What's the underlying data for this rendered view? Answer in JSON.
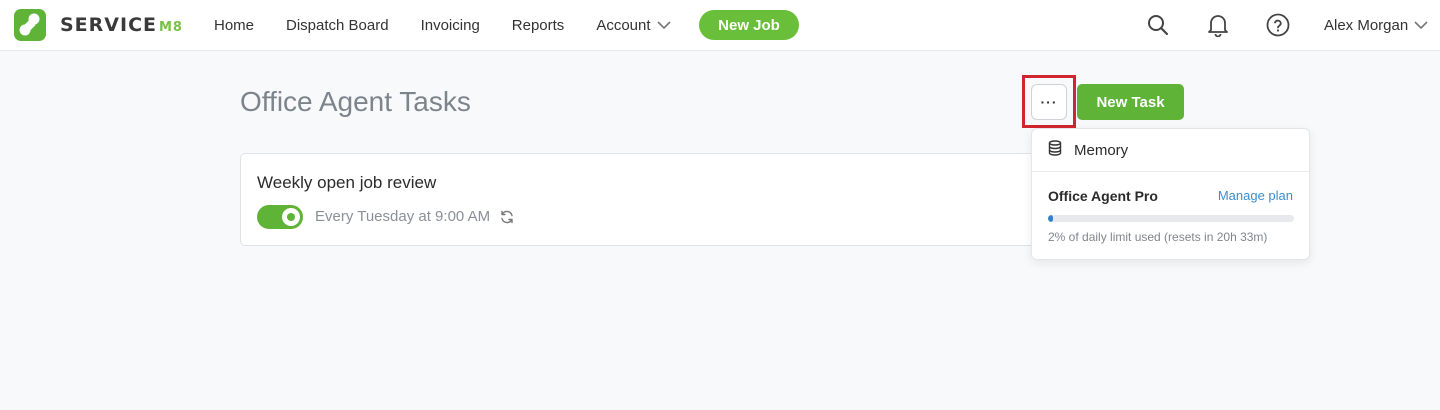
{
  "brand": {
    "name": "SERVICE",
    "suffix": "M8",
    "accent": "#5fb336"
  },
  "nav": {
    "items": [
      "Home",
      "Dispatch Board",
      "Invoicing",
      "Reports",
      "Account"
    ],
    "new_job": "New Job",
    "icons": [
      "search-icon",
      "bell-icon",
      "help-icon"
    ],
    "user": "Alex Morgan"
  },
  "page": {
    "title": "Office Agent Tasks",
    "more_label": "···",
    "new_task": "New Task"
  },
  "task": {
    "title": "Weekly open job review",
    "enabled": true,
    "schedule": "Every Tuesday at 9:00 AM",
    "icon": "repeat-icon"
  },
  "dropdown": {
    "memory_label": "Memory",
    "plan_name": "Office Agent Pro",
    "manage_link": "Manage plan",
    "usage_fraction": 0.02,
    "usage_text": "2% of daily limit used (resets in 20h 33m)"
  }
}
